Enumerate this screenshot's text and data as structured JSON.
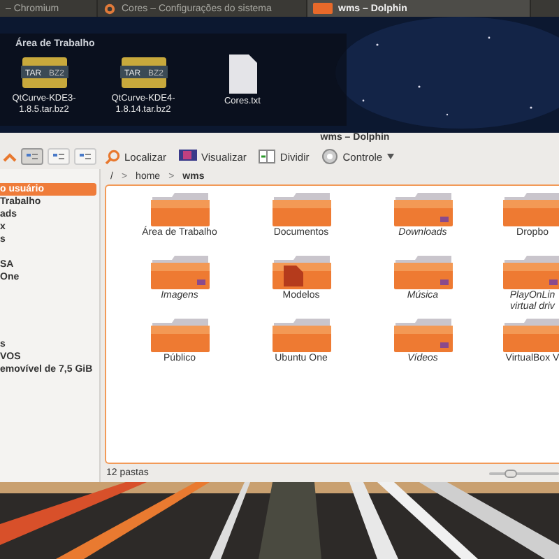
{
  "taskbar": {
    "tasks": [
      {
        "label": "– Chromium",
        "kind": "plain",
        "selected": false
      },
      {
        "label": "Cores – Configurações do sistema",
        "kind": "gear",
        "selected": false
      },
      {
        "label": "wms – Dolphin",
        "kind": "folder",
        "selected": true
      }
    ]
  },
  "desktop": {
    "title": "Área de Trabalho",
    "icons": [
      {
        "kind": "archive",
        "label": "QtCurve-KDE3-\n1.8.5.tar.bz2",
        "badge_left": "TAR",
        "badge_right": "BZ2"
      },
      {
        "kind": "archive",
        "label": "QtCurve-KDE4-\n1.8.14.tar.bz2",
        "badge_left": "TAR",
        "badge_right": "BZ2"
      },
      {
        "kind": "text",
        "label": "Cores.txt"
      }
    ]
  },
  "window": {
    "title": "wms – Dolphin"
  },
  "toolbar": {
    "view_modes": [
      {
        "selected": true
      },
      {
        "selected": false
      },
      {
        "selected": false
      }
    ],
    "buttons": [
      {
        "kind": "search",
        "label": "Localizar"
      },
      {
        "kind": "view",
        "label": "Visualizar"
      },
      {
        "kind": "split",
        "label": "Dividir"
      },
      {
        "kind": "control",
        "label": "Controle"
      }
    ]
  },
  "breadcrumb": [
    {
      "label": "/",
      "current": false
    },
    {
      "separator": ">",
      "label": "home",
      "current": false
    },
    {
      "separator": ">",
      "label": "wms",
      "current": true
    }
  ],
  "sidebar": {
    "sections": [
      {
        "items": [
          {
            "label": "o usuário",
            "selected": true
          },
          {
            "label": "Trabalho",
            "selected": false
          },
          {
            "label": "ads",
            "selected": false
          },
          {
            "label": "x",
            "selected": false
          },
          {
            "label": "s",
            "selected": false
          }
        ]
      },
      {
        "items": [
          {
            "label": "SA",
            "selected": false
          },
          {
            "label": "One",
            "selected": false
          }
        ]
      },
      {
        "items": [
          {
            "label": "s",
            "selected": false
          },
          {
            "label": "VOS",
            "selected": false
          },
          {
            "label": "emovível de 7,5 GiB",
            "selected": false
          }
        ]
      }
    ]
  },
  "folders": [
    {
      "label": "Área de Trabalho",
      "link": false,
      "kind": "plain"
    },
    {
      "label": "Documentos",
      "link": false,
      "kind": "plain"
    },
    {
      "label": "Downloads",
      "link": true,
      "kind": "plain"
    },
    {
      "label": "Dropbo",
      "link": false,
      "kind": "plain"
    },
    {
      "label": "Imagens",
      "link": true,
      "kind": "plain"
    },
    {
      "label": "Modelos",
      "link": false,
      "kind": "templates"
    },
    {
      "label": "Música",
      "link": true,
      "kind": "plain"
    },
    {
      "label": "PlayOnLin\nvirtual driv",
      "link": true,
      "kind": "plain"
    },
    {
      "label": "Público",
      "link": false,
      "kind": "plain"
    },
    {
      "label": "Ubuntu One",
      "link": false,
      "kind": "plain"
    },
    {
      "label": "Vídeos",
      "link": true,
      "kind": "plain"
    },
    {
      "label": "VirtualBox V",
      "link": false,
      "kind": "plain"
    }
  ],
  "status": {
    "text": "12 pastas",
    "zoom": {
      "level": 0.3
    }
  }
}
